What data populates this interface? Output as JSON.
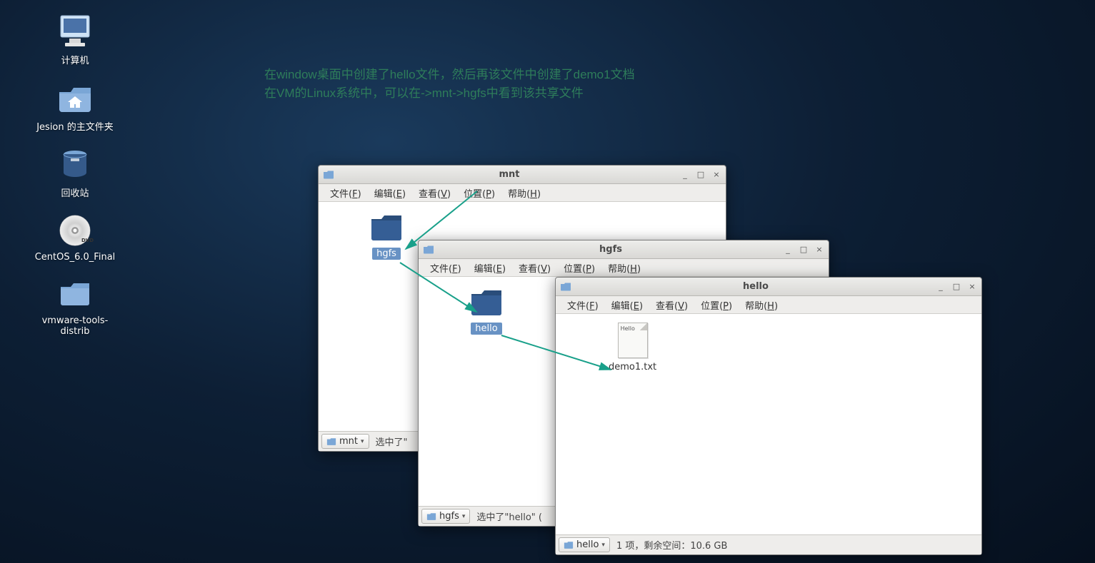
{
  "desktop": {
    "computer": "计算机",
    "home": "Jesion 的主文件夹",
    "trash": "回收站",
    "dvd": "CentOS_6.0_Final",
    "vmtools_l1": "vmware-tools-",
    "vmtools_l2": "distrib"
  },
  "annotation": {
    "line1": "在window桌面中创建了hello文件，然后再该文件中创建了demo1文档",
    "line2": "在VM的Linux系统中，可以在->mnt->hgfs中看到该共享文件"
  },
  "menu": {
    "file": "文件(",
    "file_k": "F",
    "edit": "编辑(",
    "edit_k": "E",
    "view": "查看(",
    "view_k": "V",
    "places": "位置(",
    "places_k": "P",
    "help": "帮助(",
    "help_k": "H",
    "close": ")"
  },
  "win1": {
    "title": "mnt",
    "folder": "hgfs",
    "path_label": "mnt",
    "status": "选中了\""
  },
  "win2": {
    "title": "hgfs",
    "folder": "hello",
    "path_label": "hgfs",
    "status": "选中了\"hello\" ("
  },
  "win3": {
    "title": "hello",
    "file": "demo1.txt",
    "file_preview": "Hello",
    "path_label": "hello",
    "status": "1 项，剩余空间：10.6 GB"
  }
}
